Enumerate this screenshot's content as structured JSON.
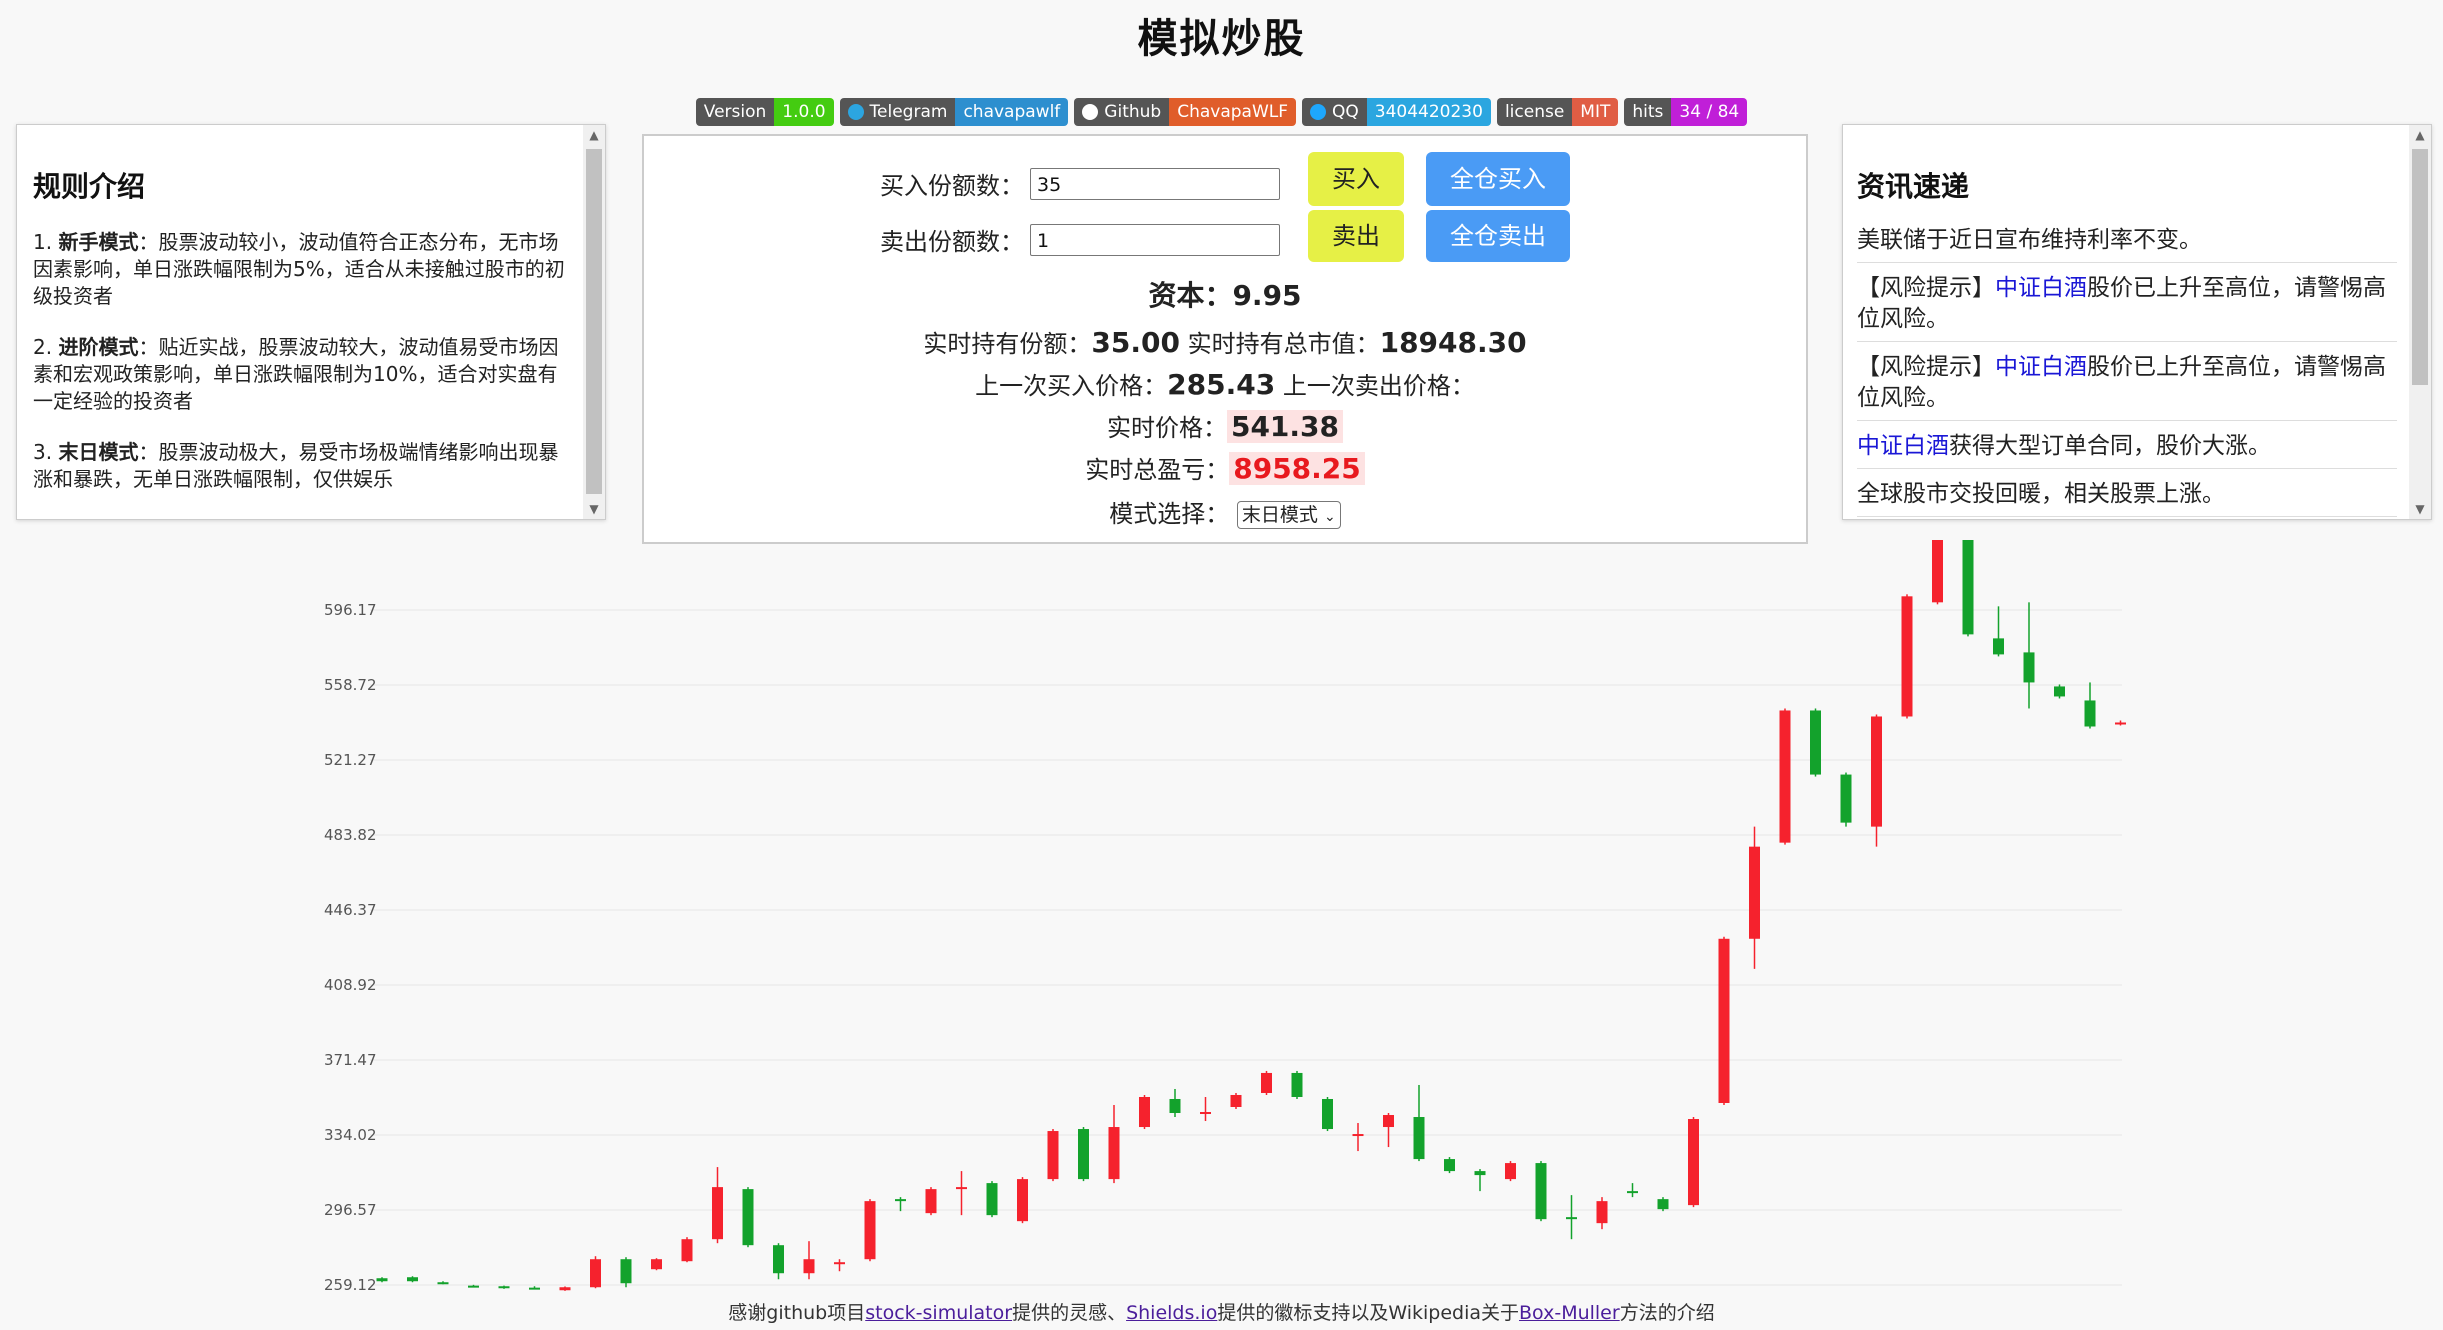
{
  "title": "模拟炒股",
  "badges": [
    {
      "label": "Version",
      "value": "1.0.0",
      "color": "#44cc11",
      "icon": ""
    },
    {
      "label": "Telegram",
      "value": "chavapawlf",
      "color": "#2d8fcf",
      "icon": "telegram-icon"
    },
    {
      "label": "Github",
      "value": "ChavapaWLF",
      "color": "#e05d2a",
      "icon": "github-icon"
    },
    {
      "label": "QQ",
      "value": "3404420230",
      "color": "#2ba6e0",
      "icon": "qq-icon"
    },
    {
      "label": "license",
      "value": "MIT",
      "color": "#e05d44",
      "icon": ""
    },
    {
      "label": "hits",
      "value": "34 / 84",
      "color": "#c01fd8",
      "icon": ""
    }
  ],
  "rules": {
    "title": "规则介绍",
    "items": [
      {
        "num": "1.",
        "name": "新手模式",
        "text": "：股票波动较小，波动值符合正态分布，无市场因素影响，单日涨跌幅限制为5%，适合从未接触过股市的初级投资者"
      },
      {
        "num": "2.",
        "name": "进阶模式",
        "text": "：贴近实战，股票波动较大，波动值易受市场因素和宏观政策影响，单日涨跌幅限制为10%，适合对实盘有一定经验的投资者"
      },
      {
        "num": "3.",
        "name": "末日模式",
        "text": "：股票波动极大，易受市场极端情绪影响出现暴涨和暴跌，无单日涨跌幅限制，仅供娱乐"
      }
    ]
  },
  "news": {
    "title": "资讯速递",
    "items": [
      {
        "link": "",
        "text": "美联储于近日宣布维持利率不变。",
        "pre": ""
      },
      {
        "pre": "【风险提示】",
        "link": "中证白酒",
        "text": "股价已上升至高位，请警惕高位风险。"
      },
      {
        "pre": "【风险提示】",
        "link": "中证白酒",
        "text": "股价已上升至高位，请警惕高位风险。"
      },
      {
        "pre": "",
        "link": "中证白酒",
        "text": "获得大型订单合同，股价大涨。"
      },
      {
        "pre": "",
        "link": "",
        "text": "全球股市交投回暖，相关股票上涨。"
      }
    ]
  },
  "trade": {
    "buy_label": "买入份额数：",
    "buy_value": "35",
    "sell_label": "卖出份额数：",
    "sell_value": "1",
    "buy_btn": "买入",
    "sell_btn": "卖出",
    "buy_all_btn": "全仓买入",
    "sell_all_btn": "全仓卖出",
    "capital_label": "资本：",
    "capital_value": "9.95",
    "hold_label": "实时持有份额：",
    "hold_value": "35.00",
    "hold_mv_label": "实时持有总市值：",
    "hold_mv_value": "18948.30",
    "last_buy_label": "上一次买入价格：",
    "last_buy_value": "285.43",
    "last_sell_label": "上一次卖出价格：",
    "price_label": "实时价格：",
    "price_value": "541.38",
    "pnl_label": "实时总盈亏：",
    "pnl_value": "8958.25",
    "mode_label": "模式选择：",
    "mode_value": "末日模式"
  },
  "chart_data": {
    "type": "candlestick",
    "y_ticks": [
      "259.12",
      "296.57",
      "334.02",
      "371.47",
      "408.92",
      "446.37",
      "483.82",
      "521.27",
      "558.72",
      "596.17"
    ],
    "ylim": [
      259.12,
      633.62
    ],
    "up_color": "#f5222d",
    "down_color": "#13a22c",
    "candles": [
      {
        "o": 262.5,
        "c": 261.0,
        "h": 263.0,
        "l": 260.5
      },
      {
        "o": 263.0,
        "c": 261.0,
        "h": 263.5,
        "l": 260.5
      },
      {
        "o": 260.5,
        "c": 259.8,
        "h": 261.0,
        "l": 259.5
      },
      {
        "o": 258.8,
        "c": 258.3,
        "h": 259.2,
        "l": 258.0
      },
      {
        "o": 258.5,
        "c": 257.5,
        "h": 258.8,
        "l": 257.2
      },
      {
        "o": 257.8,
        "c": 257.3,
        "h": 258.5,
        "l": 257.0
      },
      {
        "o": 256.5,
        "c": 258.0,
        "h": 258.4,
        "l": 256.2
      },
      {
        "o": 258.0,
        "c": 272.0,
        "h": 273.5,
        "l": 257.5
      },
      {
        "o": 272.0,
        "c": 260.0,
        "h": 273.0,
        "l": 258.0
      },
      {
        "o": 267.0,
        "c": 272.0,
        "h": 272.5,
        "l": 266.5
      },
      {
        "o": 271.0,
        "c": 282.0,
        "h": 283.0,
        "l": 270.5
      },
      {
        "o": 282.0,
        "c": 308.0,
        "h": 318.0,
        "l": 280.0
      },
      {
        "o": 307.0,
        "c": 279.0,
        "h": 308.0,
        "l": 278.0
      },
      {
        "o": 279.0,
        "c": 265.0,
        "h": 280.0,
        "l": 262.0
      },
      {
        "o": 265.0,
        "c": 272.0,
        "h": 281.0,
        "l": 262.0
      },
      {
        "o": 270.0,
        "c": 270.5,
        "h": 272.0,
        "l": 266.0
      },
      {
        "o": 272.0,
        "c": 301.0,
        "h": 302.0,
        "l": 271.0
      },
      {
        "o": 302.0,
        "c": 301.0,
        "h": 303.0,
        "l": 296.0
      },
      {
        "o": 295.0,
        "c": 307.0,
        "h": 308.0,
        "l": 294.0
      },
      {
        "o": 308.0,
        "c": 308.0,
        "h": 316.0,
        "l": 294.0
      },
      {
        "o": 310.0,
        "c": 294.0,
        "h": 311.0,
        "l": 293.0
      },
      {
        "o": 291.0,
        "c": 312.0,
        "h": 313.0,
        "l": 290.0
      },
      {
        "o": 312.0,
        "c": 336.0,
        "h": 337.0,
        "l": 311.0
      },
      {
        "o": 337.0,
        "c": 312.0,
        "h": 338.0,
        "l": 311.0
      },
      {
        "o": 312.0,
        "c": 338.0,
        "h": 349.0,
        "l": 310.0
      },
      {
        "o": 338.0,
        "c": 353.0,
        "h": 354.0,
        "l": 337.0
      },
      {
        "o": 352.0,
        "c": 345.0,
        "h": 357.0,
        "l": 343.0
      },
      {
        "o": 345.0,
        "c": 345.5,
        "h": 353.0,
        "l": 341.0
      },
      {
        "o": 348.0,
        "c": 354.0,
        "h": 355.0,
        "l": 347.0
      },
      {
        "o": 355.0,
        "c": 365.0,
        "h": 366.0,
        "l": 354.0
      },
      {
        "o": 365.0,
        "c": 353.0,
        "h": 366.0,
        "l": 352.0
      },
      {
        "o": 352.0,
        "c": 337.0,
        "h": 353.0,
        "l": 336.0
      },
      {
        "o": 334.0,
        "c": 334.5,
        "h": 340.0,
        "l": 326.0
      },
      {
        "o": 338.0,
        "c": 344.0,
        "h": 345.0,
        "l": 328.0
      },
      {
        "o": 343.0,
        "c": 322.0,
        "h": 359.0,
        "l": 321.0
      },
      {
        "o": 322.0,
        "c": 316.0,
        "h": 323.0,
        "l": 315.0
      },
      {
        "o": 316.0,
        "c": 314.0,
        "h": 317.0,
        "l": 306.0
      },
      {
        "o": 312.0,
        "c": 320.0,
        "h": 321.0,
        "l": 311.0
      },
      {
        "o": 320.0,
        "c": 292.0,
        "h": 321.0,
        "l": 291.0
      },
      {
        "o": 293.0,
        "c": 292.0,
        "h": 304.0,
        "l": 282.0
      },
      {
        "o": 290.0,
        "c": 301.0,
        "h": 303.0,
        "l": 287.0
      },
      {
        "o": 306.0,
        "c": 305.5,
        "h": 310.0,
        "l": 303.0
      },
      {
        "o": 302.0,
        "c": 297.0,
        "h": 303.0,
        "l": 296.0
      },
      {
        "o": 299.0,
        "c": 342.0,
        "h": 343.0,
        "l": 298.0
      },
      {
        "o": 350.0,
        "c": 432.0,
        "h": 433.0,
        "l": 349.0
      },
      {
        "o": 432.0,
        "c": 478.0,
        "h": 488.0,
        "l": 417.0
      },
      {
        "o": 480.0,
        "c": 546.0,
        "h": 547.0,
        "l": 479.0
      },
      {
        "o": 546.0,
        "c": 514.0,
        "h": 547.0,
        "l": 513.0
      },
      {
        "o": 514.0,
        "c": 490.0,
        "h": 515.0,
        "l": 488.0
      },
      {
        "o": 488.0,
        "c": 543.0,
        "h": 544.0,
        "l": 478.0
      },
      {
        "o": 543.0,
        "c": 603.0,
        "h": 604.0,
        "l": 542.0
      },
      {
        "o": 600.0,
        "c": 650.0,
        "h": 655.0,
        "l": 599.0
      },
      {
        "o": 650.0,
        "c": 584.0,
        "h": 651.0,
        "l": 583.0
      },
      {
        "o": 582.0,
        "c": 574.0,
        "h": 598.0,
        "l": 573.0
      },
      {
        "o": 575.0,
        "c": 560.0,
        "h": 600.0,
        "l": 547.0
      },
      {
        "o": 558.0,
        "c": 553.0,
        "h": 559.0,
        "l": 552.0
      },
      {
        "o": 551.0,
        "c": 538.0,
        "h": 560.0,
        "l": 537.0
      },
      {
        "o": 539.0,
        "c": 540.0,
        "h": 541.0,
        "l": 538.5
      }
    ]
  },
  "footer": {
    "p1": "感谢github项目",
    "l1": "stock-simulator",
    "p2": "提供的灵感、",
    "l2": "Shields.io",
    "p3": "提供的徽标支持以及Wikipedia关于",
    "l3": "Box-Muller",
    "p4": "方法的介绍"
  }
}
